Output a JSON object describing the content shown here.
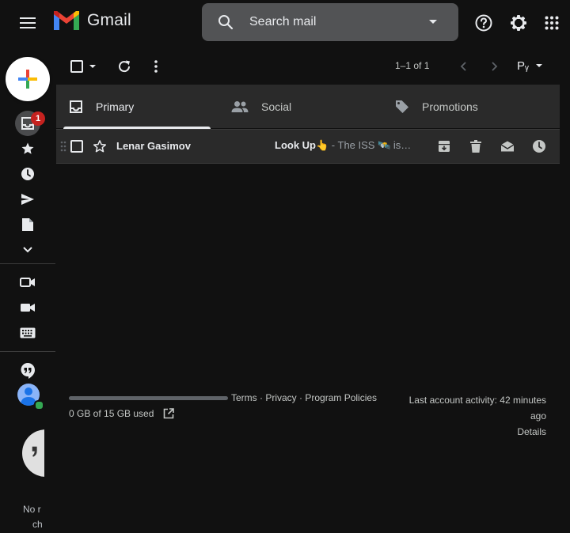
{
  "header": {
    "app_name": "Gmail",
    "search_placeholder": "Search mail"
  },
  "rail": {
    "inbox_badge": "1",
    "notes": [
      "No r",
      "ch"
    ]
  },
  "toolbar": {
    "pagination": "1–1 of 1",
    "input_tool_label": "Pᵧ"
  },
  "tabs": [
    {
      "label": "Primary",
      "active": true
    },
    {
      "label": "Social",
      "active": false
    },
    {
      "label": "Promotions",
      "active": false
    }
  ],
  "emails": [
    {
      "sender": "Lenar Gasimov",
      "subject": "Look Up👆",
      "snippet": " - The ISS 🛰️ is…"
    }
  ],
  "footer": {
    "storage": "0 GB of 15 GB used",
    "links": [
      "Terms",
      "Privacy",
      "Program Policies"
    ],
    "separator": " · ",
    "activity_line1": "Last account activity: 42 minutes",
    "activity_line2": "ago",
    "details": "Details"
  },
  "colors": {
    "background": "#111111",
    "surface": "#2a2a2a",
    "search_bg": "#525355",
    "badge": "#c5221f",
    "text": "#e8eaed",
    "muted": "#9aa0a6"
  }
}
